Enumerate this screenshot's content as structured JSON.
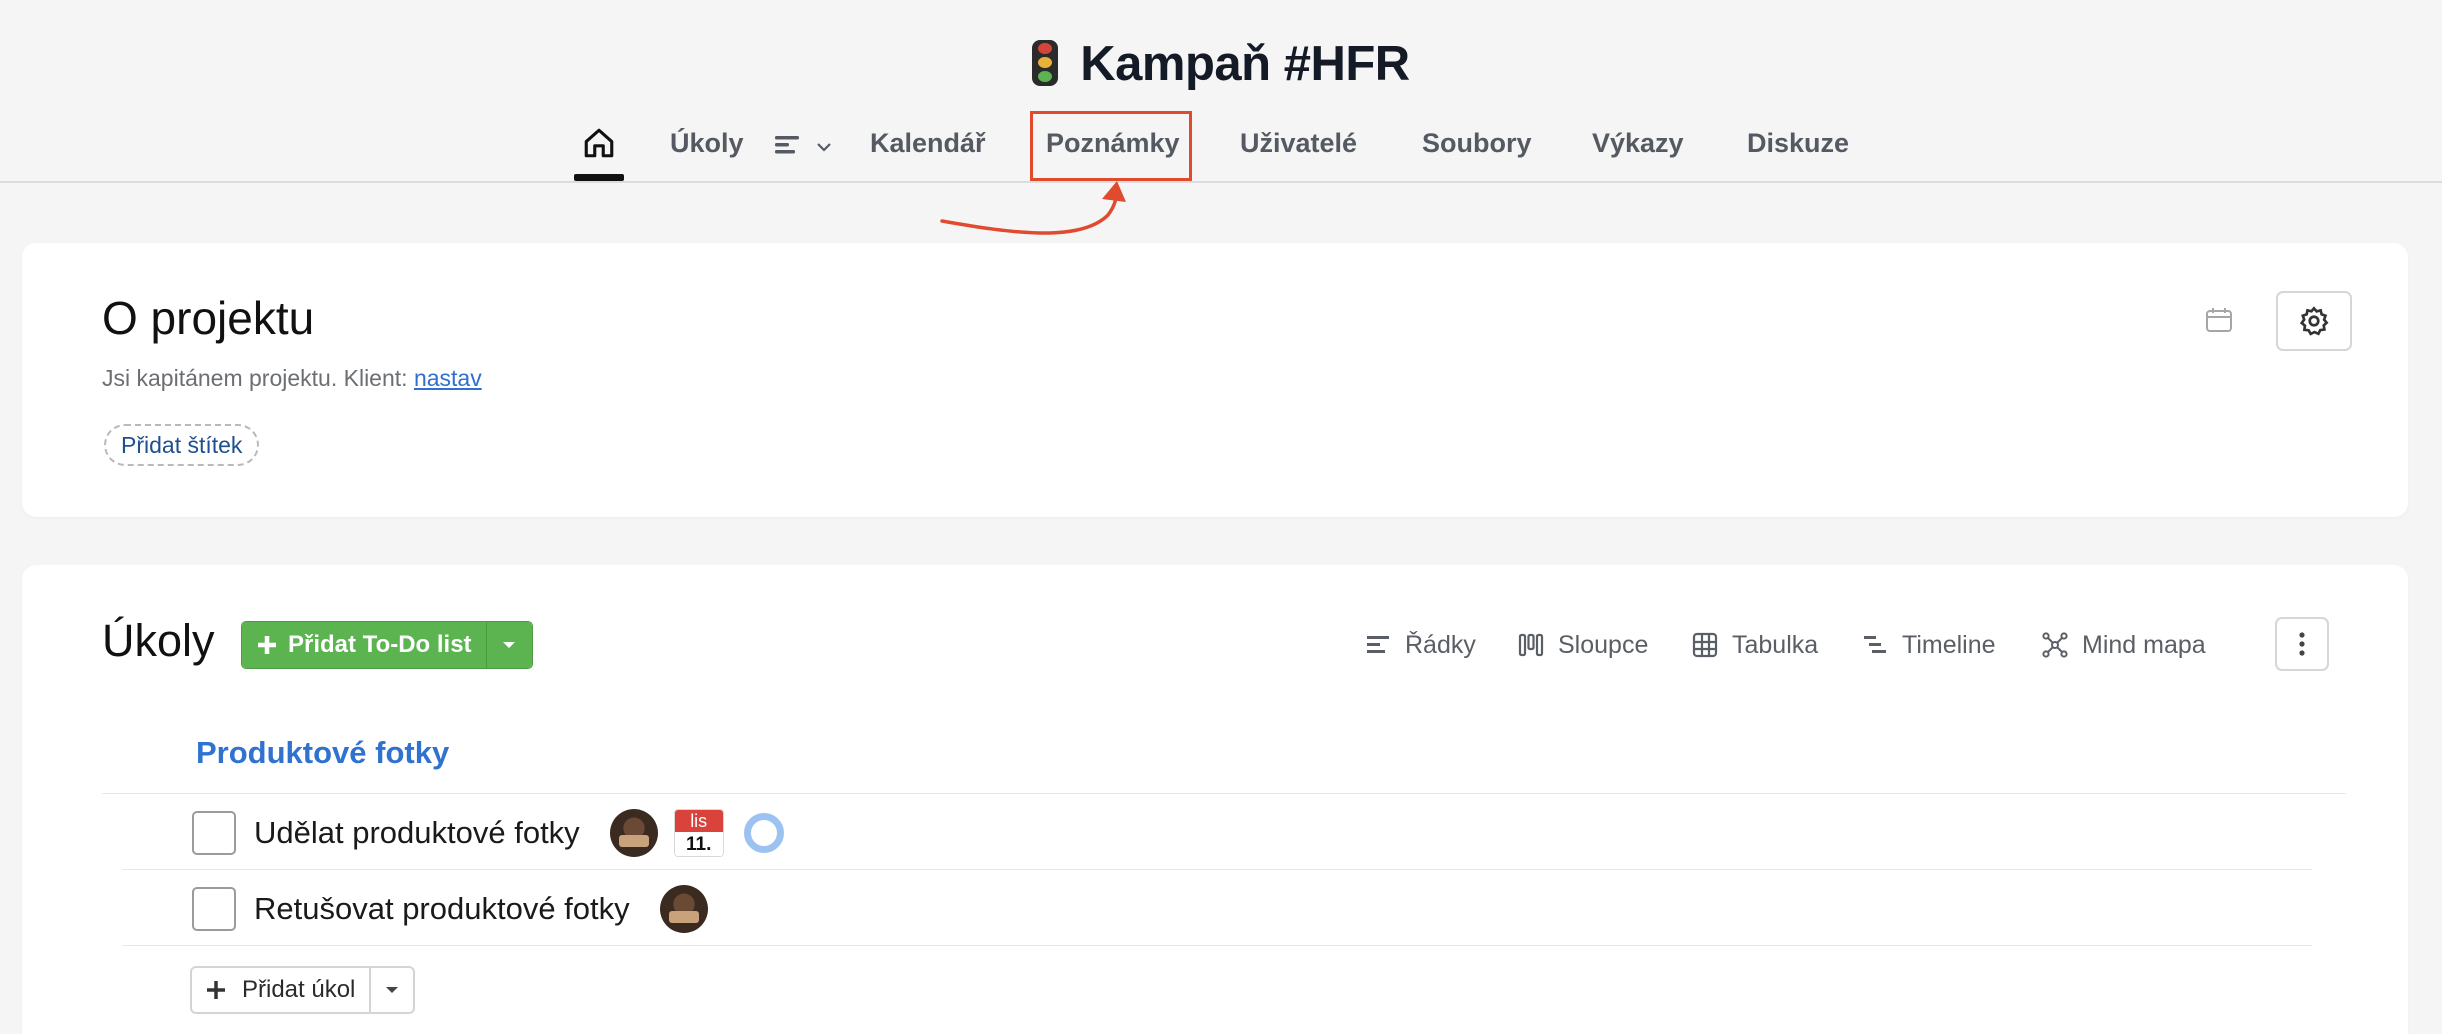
{
  "header": {
    "title": "Kampaň #HFR",
    "title_icon": "traffic-light-icon",
    "nav": [
      {
        "label": "",
        "icon": "home-icon",
        "active": true
      },
      {
        "label": "Úkoly"
      },
      {
        "label": "Kalendář"
      },
      {
        "label": "Poznámky",
        "highlighted": true
      },
      {
        "label": "Uživatelé"
      },
      {
        "label": "Soubory"
      },
      {
        "label": "Výkazy"
      },
      {
        "label": "Diskuze"
      }
    ],
    "highlight_color": "#e04a2f"
  },
  "about": {
    "title": "O projektu",
    "subtitle_prefix": "Jsi kapitánem projektu. Klient:",
    "subtitle_link": "nastav",
    "tag_button": "Přidat štítek"
  },
  "tasks": {
    "title": "Úkoly",
    "add_todo_label": "Přidat To-Do list",
    "add_todo_color": "#5cb450",
    "views": [
      {
        "label": "Řádky",
        "icon": "rows-icon"
      },
      {
        "label": "Sloupce",
        "icon": "columns-icon"
      },
      {
        "label": "Tabulka",
        "icon": "table-icon"
      },
      {
        "label": "Timeline",
        "icon": "timeline-icon"
      },
      {
        "label": "Mind mapa",
        "icon": "mind-map-icon"
      }
    ],
    "list": {
      "title": "Produktové fotky",
      "items": [
        {
          "text": "Udělat produktové fotky",
          "date_month": "lis",
          "date_day": "11."
        },
        {
          "text": "Retušovat produktové fotky"
        }
      ]
    },
    "add_task_label": "Přidat úkol"
  }
}
